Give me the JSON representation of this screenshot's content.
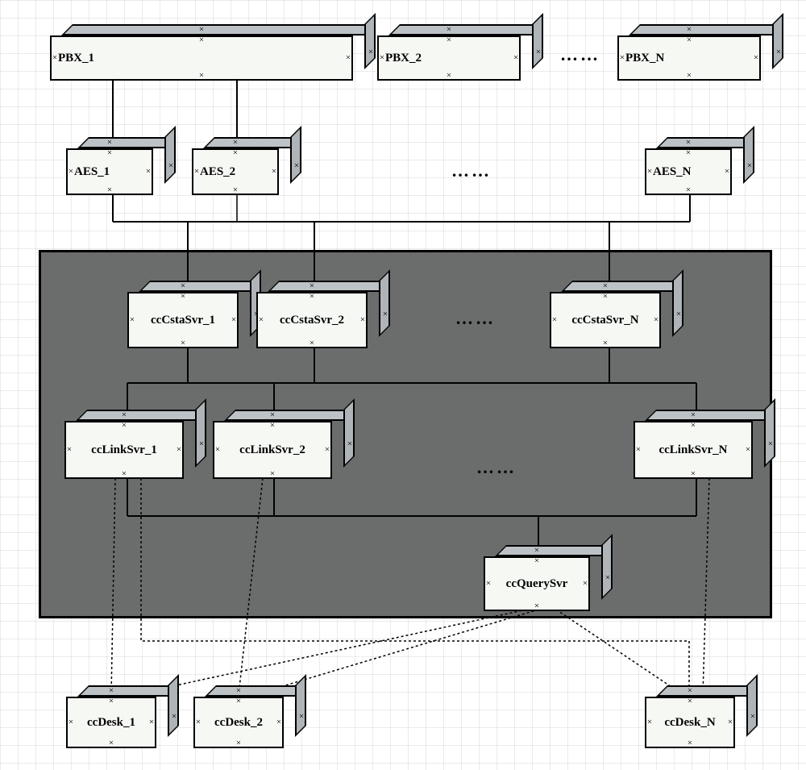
{
  "diagram": {
    "type": "architecture-block-diagram",
    "rows": [
      {
        "name": "PBX",
        "boxes": [
          {
            "id": "pbx1",
            "label": "PBX_1"
          },
          {
            "id": "pbx2",
            "label": "PBX_2"
          },
          {
            "id": "pbxN",
            "label": "PBX_N"
          }
        ],
        "ellipsis": true
      },
      {
        "name": "AES",
        "boxes": [
          {
            "id": "aes1",
            "label": "AES_1"
          },
          {
            "id": "aes2",
            "label": "AES_2"
          },
          {
            "id": "aesN",
            "label": "AES_N"
          }
        ],
        "ellipsis": true
      },
      {
        "name": "ccCstaSvr",
        "boxes": [
          {
            "id": "csta1",
            "label": "ccCstaSvr_1"
          },
          {
            "id": "csta2",
            "label": "ccCstaSvr_2"
          },
          {
            "id": "cstaN",
            "label": "ccCstaSvr_N"
          }
        ],
        "ellipsis": true
      },
      {
        "name": "ccLinkSvr",
        "boxes": [
          {
            "id": "link1",
            "label": "ccLinkSvr_1"
          },
          {
            "id": "link2",
            "label": "ccLinkSvr_2"
          },
          {
            "id": "linkN",
            "label": "ccLinkSvr_N"
          }
        ],
        "ellipsis": true
      },
      {
        "name": "ccQuerySvr",
        "boxes": [
          {
            "id": "query",
            "label": "ccQuerySvr"
          }
        ],
        "ellipsis": false
      },
      {
        "name": "ccDesk",
        "boxes": [
          {
            "id": "desk1",
            "label": "ccDesk_1"
          },
          {
            "id": "desk2",
            "label": "ccDesk_2"
          },
          {
            "id": "deskN",
            "label": "ccDesk_N"
          }
        ],
        "ellipsis": false
      }
    ],
    "connections": [
      {
        "from": "pbx1",
        "to": "aes1",
        "style": "solid"
      },
      {
        "from": "pbx1",
        "to": "aes2",
        "style": "solid"
      },
      {
        "from": "pbx2",
        "to": "aesN",
        "style": "implied"
      },
      {
        "from": "pbxN",
        "to": "aesN",
        "style": "implied"
      },
      {
        "from": "aes1",
        "to": "csta1",
        "style": "solid"
      },
      {
        "from": "aes2",
        "to": "csta2",
        "style": "solid"
      },
      {
        "from": "aesN",
        "to": "cstaN",
        "style": "solid"
      },
      {
        "from": "csta1",
        "to": "link1",
        "style": "bus"
      },
      {
        "from": "csta1",
        "to": "link2",
        "style": "bus"
      },
      {
        "from": "csta1",
        "to": "linkN",
        "style": "bus"
      },
      {
        "from": "csta2",
        "to": "link1",
        "style": "bus"
      },
      {
        "from": "csta2",
        "to": "link2",
        "style": "bus"
      },
      {
        "from": "csta2",
        "to": "linkN",
        "style": "bus"
      },
      {
        "from": "cstaN",
        "to": "link1",
        "style": "bus"
      },
      {
        "from": "cstaN",
        "to": "link2",
        "style": "bus"
      },
      {
        "from": "cstaN",
        "to": "linkN",
        "style": "bus"
      },
      {
        "from": "link1",
        "to": "query",
        "style": "bus"
      },
      {
        "from": "link2",
        "to": "query",
        "style": "bus"
      },
      {
        "from": "linkN",
        "to": "query",
        "style": "bus"
      },
      {
        "from": "link1",
        "to": "desk1",
        "style": "dashed"
      },
      {
        "from": "link1",
        "to": "deskN",
        "style": "dashed"
      },
      {
        "from": "link2",
        "to": "desk2",
        "style": "dashed"
      },
      {
        "from": "linkN",
        "to": "deskN",
        "style": "dashed"
      },
      {
        "from": "query",
        "to": "desk1",
        "style": "dashed"
      },
      {
        "from": "query",
        "to": "desk2",
        "style": "dashed"
      },
      {
        "from": "query",
        "to": "deskN",
        "style": "dashed"
      }
    ],
    "panel": {
      "contains": [
        "ccCstaSvr",
        "ccLinkSvr",
        "ccQuerySvr"
      ]
    }
  },
  "ellipsis": "……"
}
